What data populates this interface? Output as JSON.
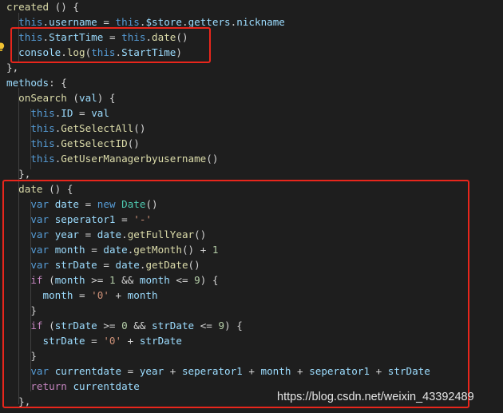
{
  "editor": {
    "lines": [
      [
        {
          "t": "created",
          "c": "fn"
        },
        {
          "t": " () {",
          "c": "op"
        }
      ],
      [
        {
          "t": "  "
        },
        {
          "t": "this",
          "c": "kw"
        },
        {
          "t": ".",
          "c": "op"
        },
        {
          "t": "username",
          "c": "var"
        },
        {
          "t": " = ",
          "c": "op"
        },
        {
          "t": "this",
          "c": "kw"
        },
        {
          "t": ".",
          "c": "op"
        },
        {
          "t": "$store",
          "c": "var"
        },
        {
          "t": ".",
          "c": "op"
        },
        {
          "t": "getters",
          "c": "var"
        },
        {
          "t": ".",
          "c": "op"
        },
        {
          "t": "nickname",
          "c": "var"
        }
      ],
      [
        {
          "t": "  "
        },
        {
          "t": "this",
          "c": "kw"
        },
        {
          "t": ".",
          "c": "op"
        },
        {
          "t": "StartTime",
          "c": "var"
        },
        {
          "t": " = ",
          "c": "op"
        },
        {
          "t": "this",
          "c": "kw"
        },
        {
          "t": ".",
          "c": "op"
        },
        {
          "t": "date",
          "c": "fn"
        },
        {
          "t": "()",
          "c": "op"
        }
      ],
      [
        {
          "t": "  "
        },
        {
          "t": "console",
          "c": "var"
        },
        {
          "t": ".",
          "c": "op"
        },
        {
          "t": "log",
          "c": "fn"
        },
        {
          "t": "(",
          "c": "op"
        },
        {
          "t": "this",
          "c": "kw"
        },
        {
          "t": ".",
          "c": "op"
        },
        {
          "t": "StartTime",
          "c": "var"
        },
        {
          "t": ")",
          "c": "op"
        }
      ],
      [
        {
          "t": "},",
          "c": "op"
        }
      ],
      [
        {
          "t": "methods",
          "c": "var"
        },
        {
          "t": ": {",
          "c": "op"
        }
      ],
      [
        {
          "t": "  "
        },
        {
          "t": "onSearch",
          "c": "fn"
        },
        {
          "t": " (",
          "c": "op"
        },
        {
          "t": "val",
          "c": "var"
        },
        {
          "t": ") {",
          "c": "op"
        }
      ],
      [
        {
          "t": "    "
        },
        {
          "t": "this",
          "c": "kw"
        },
        {
          "t": ".",
          "c": "op"
        },
        {
          "t": "ID",
          "c": "var"
        },
        {
          "t": " = ",
          "c": "op"
        },
        {
          "t": "val",
          "c": "var"
        }
      ],
      [
        {
          "t": "    "
        },
        {
          "t": "this",
          "c": "kw"
        },
        {
          "t": ".",
          "c": "op"
        },
        {
          "t": "GetSelectAll",
          "c": "fn"
        },
        {
          "t": "()",
          "c": "op"
        }
      ],
      [
        {
          "t": "    "
        },
        {
          "t": "this",
          "c": "kw"
        },
        {
          "t": ".",
          "c": "op"
        },
        {
          "t": "GetSelectID",
          "c": "fn"
        },
        {
          "t": "()",
          "c": "op"
        }
      ],
      [
        {
          "t": "    "
        },
        {
          "t": "this",
          "c": "kw"
        },
        {
          "t": ".",
          "c": "op"
        },
        {
          "t": "GetUserManagerbyusername",
          "c": "fn"
        },
        {
          "t": "()",
          "c": "op"
        }
      ],
      [
        {
          "t": "  "
        },
        {
          "t": "},",
          "c": "op"
        }
      ],
      [
        {
          "t": "  "
        },
        {
          "t": "date",
          "c": "fn"
        },
        {
          "t": " () {",
          "c": "op"
        }
      ],
      [
        {
          "t": "    "
        },
        {
          "t": "var",
          "c": "kw"
        },
        {
          "t": " "
        },
        {
          "t": "date",
          "c": "var"
        },
        {
          "t": " = ",
          "c": "op"
        },
        {
          "t": "new",
          "c": "kw"
        },
        {
          "t": " "
        },
        {
          "t": "Date",
          "c": "cls"
        },
        {
          "t": "()",
          "c": "op"
        }
      ],
      [
        {
          "t": "    "
        },
        {
          "t": "var",
          "c": "kw"
        },
        {
          "t": " "
        },
        {
          "t": "seperator1",
          "c": "var"
        },
        {
          "t": " = ",
          "c": "op"
        },
        {
          "t": "'-'",
          "c": "str"
        }
      ],
      [
        {
          "t": "    "
        },
        {
          "t": "var",
          "c": "kw"
        },
        {
          "t": " "
        },
        {
          "t": "year",
          "c": "var"
        },
        {
          "t": " = ",
          "c": "op"
        },
        {
          "t": "date",
          "c": "var"
        },
        {
          "t": ".",
          "c": "op"
        },
        {
          "t": "getFullYear",
          "c": "fn"
        },
        {
          "t": "()",
          "c": "op"
        }
      ],
      [
        {
          "t": "    "
        },
        {
          "t": "var",
          "c": "kw"
        },
        {
          "t": " "
        },
        {
          "t": "month",
          "c": "var"
        },
        {
          "t": " = ",
          "c": "op"
        },
        {
          "t": "date",
          "c": "var"
        },
        {
          "t": ".",
          "c": "op"
        },
        {
          "t": "getMonth",
          "c": "fn"
        },
        {
          "t": "() + ",
          "c": "op"
        },
        {
          "t": "1",
          "c": "num"
        }
      ],
      [
        {
          "t": "    "
        },
        {
          "t": "var",
          "c": "kw"
        },
        {
          "t": " "
        },
        {
          "t": "strDate",
          "c": "var"
        },
        {
          "t": " = ",
          "c": "op"
        },
        {
          "t": "date",
          "c": "var"
        },
        {
          "t": ".",
          "c": "op"
        },
        {
          "t": "getDate",
          "c": "fn"
        },
        {
          "t": "()",
          "c": "op"
        }
      ],
      [
        {
          "t": "    "
        },
        {
          "t": "if",
          "c": "ctl"
        },
        {
          "t": " (",
          "c": "op"
        },
        {
          "t": "month",
          "c": "var"
        },
        {
          "t": " >= ",
          "c": "op"
        },
        {
          "t": "1",
          "c": "num"
        },
        {
          "t": " && ",
          "c": "op"
        },
        {
          "t": "month",
          "c": "var"
        },
        {
          "t": " <= ",
          "c": "op"
        },
        {
          "t": "9",
          "c": "num"
        },
        {
          "t": ") {",
          "c": "op"
        }
      ],
      [
        {
          "t": "      "
        },
        {
          "t": "month",
          "c": "var"
        },
        {
          "t": " = ",
          "c": "op"
        },
        {
          "t": "'0'",
          "c": "str"
        },
        {
          "t": " + ",
          "c": "op"
        },
        {
          "t": "month",
          "c": "var"
        }
      ],
      [
        {
          "t": "    "
        },
        {
          "t": "}",
          "c": "op"
        }
      ],
      [
        {
          "t": "    "
        },
        {
          "t": "if",
          "c": "ctl"
        },
        {
          "t": " (",
          "c": "op"
        },
        {
          "t": "strDate",
          "c": "var"
        },
        {
          "t": " >= ",
          "c": "op"
        },
        {
          "t": "0",
          "c": "num"
        },
        {
          "t": " && ",
          "c": "op"
        },
        {
          "t": "strDate",
          "c": "var"
        },
        {
          "t": " <= ",
          "c": "op"
        },
        {
          "t": "9",
          "c": "num"
        },
        {
          "t": ") {",
          "c": "op"
        }
      ],
      [
        {
          "t": "      "
        },
        {
          "t": "strDate",
          "c": "var"
        },
        {
          "t": " = ",
          "c": "op"
        },
        {
          "t": "'0'",
          "c": "str"
        },
        {
          "t": " + ",
          "c": "op"
        },
        {
          "t": "strDate",
          "c": "var"
        }
      ],
      [
        {
          "t": "    "
        },
        {
          "t": "}",
          "c": "op"
        }
      ],
      [
        {
          "t": "    "
        },
        {
          "t": "var",
          "c": "kw"
        },
        {
          "t": " "
        },
        {
          "t": "currentdate",
          "c": "var"
        },
        {
          "t": " = ",
          "c": "op"
        },
        {
          "t": "year",
          "c": "var"
        },
        {
          "t": " + ",
          "c": "op"
        },
        {
          "t": "seperator1",
          "c": "var"
        },
        {
          "t": " + ",
          "c": "op"
        },
        {
          "t": "month",
          "c": "var"
        },
        {
          "t": " + ",
          "c": "op"
        },
        {
          "t": "seperator1",
          "c": "var"
        },
        {
          "t": " + ",
          "c": "op"
        },
        {
          "t": "strDate",
          "c": "var"
        }
      ],
      [
        {
          "t": "    "
        },
        {
          "t": "return",
          "c": "ctl"
        },
        {
          "t": " "
        },
        {
          "t": "currentdate",
          "c": "var"
        }
      ],
      [
        {
          "t": "  "
        },
        {
          "t": "},",
          "c": "op"
        }
      ]
    ]
  },
  "highlights": [
    "created-hook-startTime-lines",
    "date-method-body"
  ],
  "colors": {
    "background": "#1e1e1e",
    "highlight_box": "#e8261c",
    "keyword": "#569cd6",
    "function": "#dcdcaa",
    "variable": "#9cdcfe",
    "string": "#ce9178",
    "number": "#b5cea8"
  },
  "icons": [
    "lightbulb-icon"
  ],
  "watermark": "https://blog.csdn.net/weixin_43392489"
}
